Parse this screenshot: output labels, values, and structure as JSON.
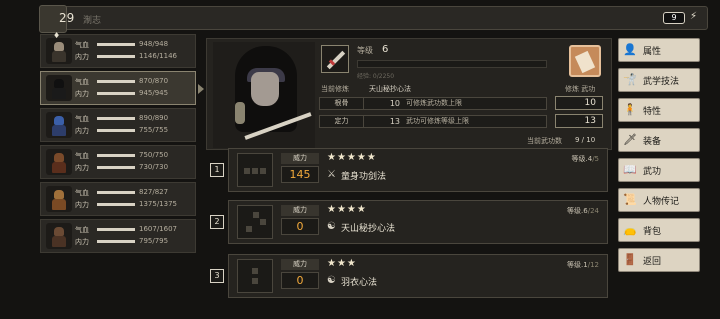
{
  "topbar": {
    "day": "29",
    "dim_label": "淛志",
    "energy": "9"
  },
  "members": [
    {
      "hp_label": "气血",
      "hp": "948/948",
      "hp_frac": 1.0,
      "in_label": "内力",
      "inner": "1146/1146",
      "in_frac": 1.0,
      "color": "#9a8c7a",
      "body": "#3a342c"
    },
    {
      "hp_label": "气血",
      "hp": "870/870",
      "hp_frac": 1.0,
      "in_label": "内力",
      "inner": "945/945",
      "in_frac": 1.0,
      "color": "#101010",
      "body": "#1a1a1a"
    },
    {
      "hp_label": "气血",
      "hp": "890/890",
      "hp_frac": 1.0,
      "in_label": "内力",
      "inner": "755/755",
      "in_frac": 1.0,
      "color": "#3b5fa8",
      "body": "#2d3d6a"
    },
    {
      "hp_label": "气血",
      "hp": "750/750",
      "hp_frac": 1.0,
      "in_label": "内力",
      "inner": "730/730",
      "in_frac": 1.0,
      "color": "#7a4a2a",
      "body": "#5a2e1c"
    },
    {
      "hp_label": "气血",
      "hp": "827/827",
      "hp_frac": 1.0,
      "in_label": "内力",
      "inner": "1375/1375",
      "in_frac": 1.0,
      "color": "#a0703a",
      "body": "#7a4a24"
    },
    {
      "hp_label": "气血",
      "hp": "1607/1607",
      "hp_frac": 1.0,
      "in_label": "内力",
      "inner": "795/795",
      "in_frac": 1.0,
      "color": "#6a4a34",
      "body": "#4a3224"
    }
  ],
  "character": {
    "level_label": "等级",
    "level": "6",
    "exp_label": "经验: 0/2250",
    "exp_frac": 0.0,
    "current_label": "当前修炼",
    "current_value": "天山秘抄心法",
    "book_label": "修炼 武功",
    "stats": [
      {
        "key": "根骨",
        "num": "10",
        "desc": "可修炼武功数上限",
        "box": "10"
      },
      {
        "key": "定力",
        "num": "13",
        "desc": "武功可修炼等级上限",
        "box": "13"
      }
    ],
    "count_label": "当前武功数",
    "count_value": "9 / 10"
  },
  "skills": [
    {
      "num": "1",
      "power_label": "威力",
      "power": "145",
      "stars": "★★★★★",
      "type_icon": "sword-icon",
      "type_glyph": "⚔",
      "name": "童身功剑法",
      "level_prefix": "等级",
      "level": "4",
      "level_max": "/5"
    },
    {
      "num": "2",
      "power_label": "威力",
      "power": "0",
      "stars": "★★★★",
      "type_icon": "yin-yang-icon",
      "type_glyph": "☯",
      "name": "天山秘抄心法",
      "level_prefix": "等级",
      "level": "6",
      "level_max": "/24"
    },
    {
      "num": "3",
      "power_label": "威力",
      "power": "0",
      "stars": "★★★",
      "type_icon": "yin-yang-icon",
      "type_glyph": "☯",
      "name": "羽衣心法",
      "level_prefix": "等级",
      "level": "1",
      "level_max": "/12"
    }
  ],
  "menu": [
    {
      "label": "属性",
      "icon": "person-icon",
      "glyph": "👤"
    },
    {
      "label": "武学技法",
      "icon": "martial-figure-icon",
      "glyph": "🤺"
    },
    {
      "label": "特性",
      "icon": "figure-icon",
      "glyph": "🧍"
    },
    {
      "label": "装备",
      "icon": "sword-icon",
      "glyph": "🗡"
    },
    {
      "label": "武功",
      "icon": "book-icon",
      "glyph": "📖"
    },
    {
      "label": "人物传记",
      "icon": "scroll-icon",
      "glyph": "📜"
    },
    {
      "label": "背包",
      "icon": "bag-icon",
      "glyph": "👝"
    },
    {
      "label": "返回",
      "icon": "return-icon",
      "glyph": "🚪"
    }
  ]
}
